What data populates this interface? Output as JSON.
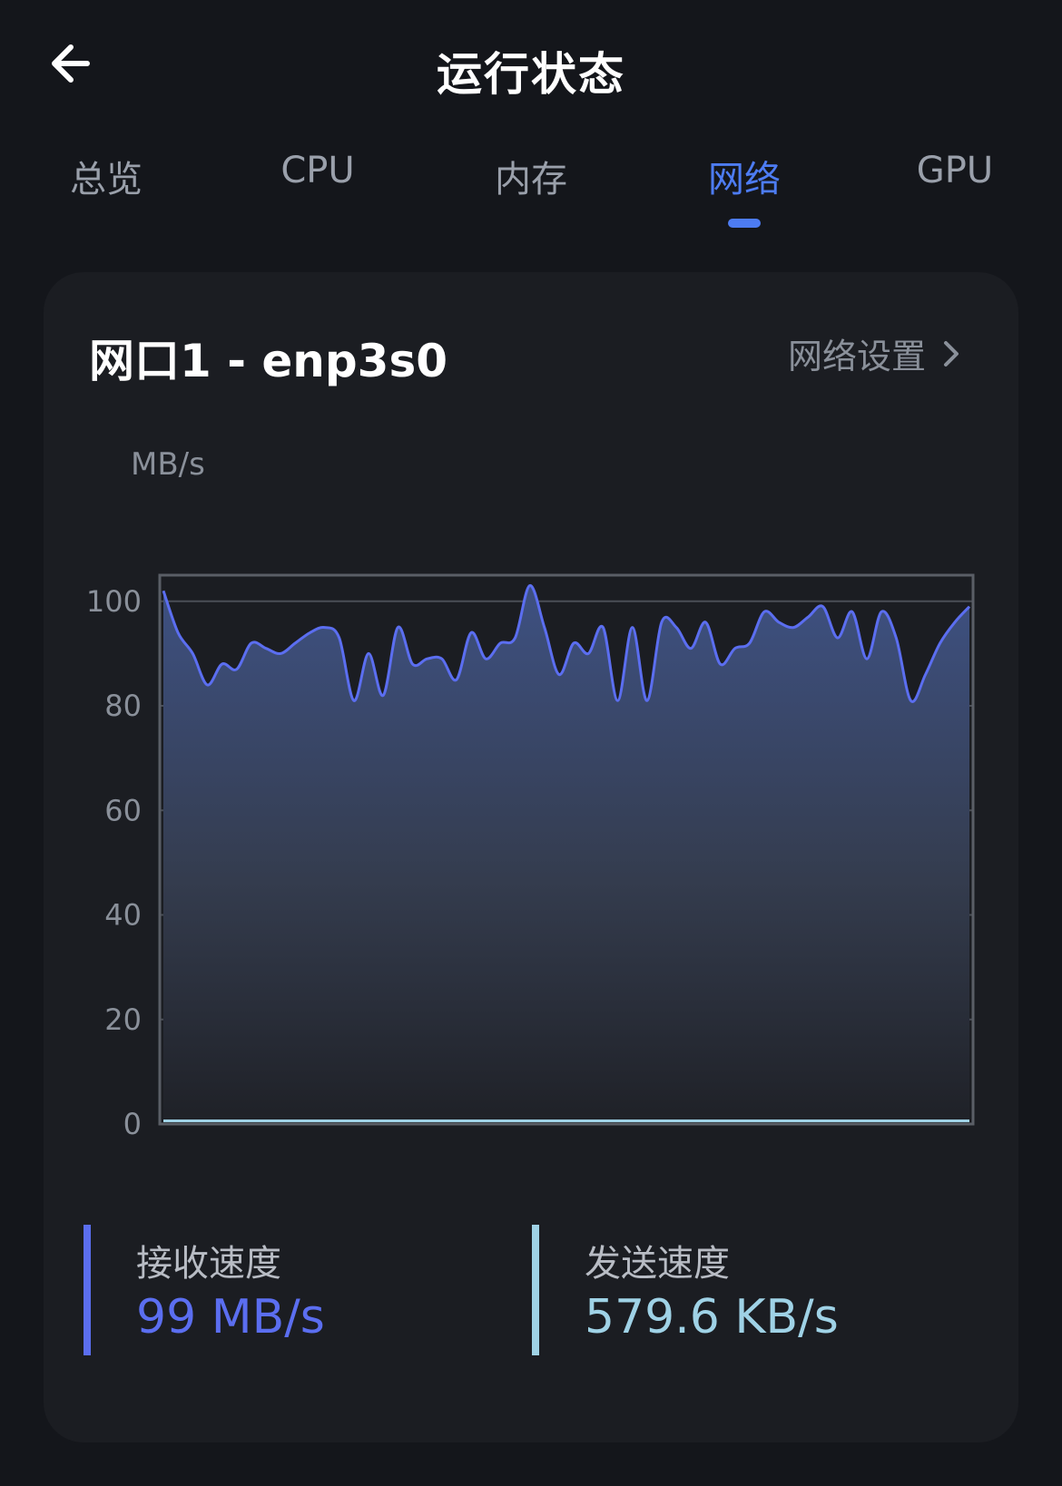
{
  "header": {
    "title": "运行状态"
  },
  "tabs": [
    {
      "label": "总览",
      "active": false
    },
    {
      "label": "CPU",
      "active": false
    },
    {
      "label": "内存",
      "active": false
    },
    {
      "label": "网络",
      "active": true
    },
    {
      "label": "GPU",
      "active": false
    }
  ],
  "card": {
    "title": "网口1 - enp3s0",
    "settings_label": "网络设置",
    "unit_label": "MB/s"
  },
  "colors": {
    "accent": "#4d7cf3",
    "receive": "#5b6ef0",
    "send": "#9fd2e6",
    "background": "#14161b",
    "card": "#1b1d22"
  },
  "icons": {
    "back": "arrow-left-icon",
    "settings_chevron": "chevron-right-icon"
  },
  "chart_data": {
    "type": "area",
    "ylabel": "MB/s",
    "ylim": [
      0,
      105
    ],
    "yticks": [
      0,
      20,
      40,
      60,
      80,
      100
    ],
    "grid": true,
    "series": [
      {
        "name": "接收速度",
        "values": [
          102,
          94,
          90,
          84,
          88,
          87,
          92,
          91,
          90,
          92,
          94,
          95,
          93,
          81,
          90,
          82,
          95,
          88,
          89,
          89,
          85,
          94,
          89,
          92,
          93,
          103,
          95,
          86,
          92,
          90,
          95,
          81,
          95,
          81,
          96,
          95,
          91,
          96,
          88,
          91,
          92,
          98,
          96,
          95,
          97,
          99,
          93,
          98,
          89,
          98,
          93,
          81,
          86,
          92,
          96,
          99
        ]
      },
      {
        "name": "发送速度",
        "values": [
          0.6,
          0.6,
          0.6,
          0.6,
          0.6,
          0.6,
          0.6,
          0.6,
          0.6,
          0.6,
          0.6,
          0.6,
          0.6,
          0.6,
          0.6,
          0.6,
          0.6,
          0.6,
          0.6,
          0.6,
          0.6,
          0.6,
          0.6,
          0.6,
          0.6,
          0.6,
          0.6,
          0.6,
          0.6,
          0.6,
          0.6,
          0.6,
          0.6,
          0.6,
          0.6,
          0.6,
          0.6,
          0.6,
          0.6,
          0.6,
          0.6,
          0.6,
          0.6,
          0.6,
          0.6,
          0.6,
          0.6,
          0.6,
          0.6,
          0.6,
          0.6,
          0.6,
          0.6,
          0.6,
          0.6,
          0.6
        ]
      }
    ]
  },
  "stats": {
    "receive": {
      "label": "接收速度",
      "value": "99 MB/s"
    },
    "send": {
      "label": "发送速度",
      "value": "579.6 KB/s"
    }
  }
}
